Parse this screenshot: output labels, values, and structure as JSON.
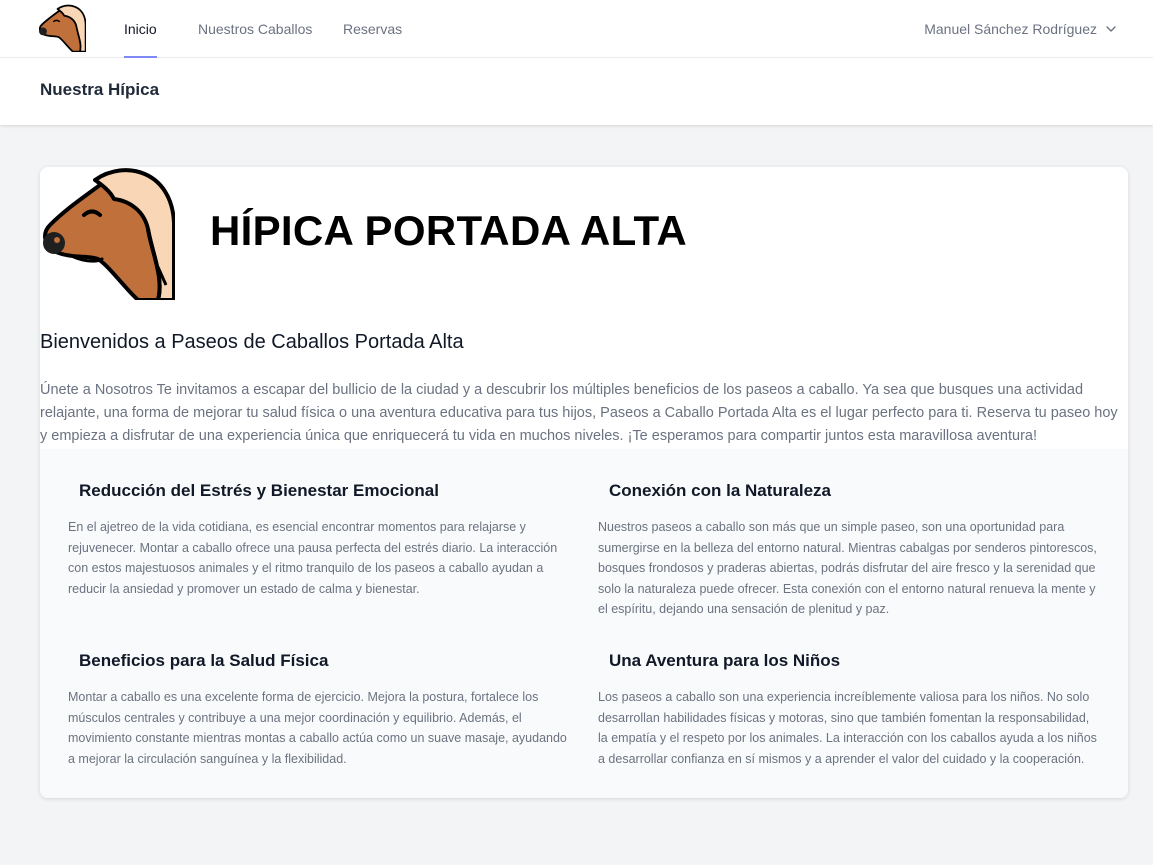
{
  "nav": {
    "links": [
      {
        "label": "Inicio",
        "active": true
      },
      {
        "label": "Nuestros Caballos",
        "active": false
      },
      {
        "label": "Reservas",
        "active": false
      }
    ],
    "user_name": "Manuel Sánchez Rodríguez",
    "logo_icon": "horse-head-icon",
    "dropdown_icon": "chevron-down-icon"
  },
  "header": {
    "title": "Nuestra Hípica"
  },
  "hero": {
    "title": "HÍPICA PORTADA ALTA",
    "image_icon": "horse-head-icon",
    "welcome": "Bienvenidos a Paseos de Caballos Portada Alta",
    "intro": "Únete a Nosotros Te invitamos a escapar del bullicio de la ciudad y a descubrir los múltiples beneficios de los paseos a caballo. Ya sea que busques una actividad relajante, una forma de mejorar tu salud física o una aventura educativa para tus hijos, Paseos a Caballo Portada Alta es el lugar perfecto para ti. Reserva tu paseo hoy y empieza a disfrutar de una experiencia única que enriquecerá tu vida en muchos niveles. ¡Te esperamos para compartir juntos esta maravillosa aventura!"
  },
  "features": [
    {
      "title": "Reducción del Estrés y Bienestar Emocional",
      "text": "En el ajetreo de la vida cotidiana, es esencial encontrar momentos para relajarse y rejuvenecer. Montar a caballo ofrece una pausa perfecta del estrés diario. La interacción con estos majestuosos animales y el ritmo tranquilo de los paseos a caballo ayudan a reducir la ansiedad y promover un estado de calma y bienestar."
    },
    {
      "title": "Conexión con la Naturaleza",
      "text": "Nuestros paseos a caballo son más que un simple paseo, son una oportunidad para sumergirse en la belleza del entorno natural. Mientras cabalgas por senderos pintorescos, bosques frondosos y praderas abiertas, podrás disfrutar del aire fresco y la serenidad que solo la naturaleza puede ofrecer. Esta conexión con el entorno natural renueva la mente y el espíritu, dejando una sensación de plenitud y paz."
    },
    {
      "title": "Beneficios para la Salud Física",
      "text": "Montar a caballo es una excelente forma de ejercicio. Mejora la postura, fortalece los músculos centrales y contribuye a una mejor coordinación y equilibrio. Además, el movimiento constante mientras montas a caballo actúa como un suave masaje, ayudando a mejorar la circulación sanguínea y la flexibilidad."
    },
    {
      "title": "Una Aventura para los Niños",
      "text": "Los paseos a caballo son una experiencia increíblemente valiosa para los niños. No solo desarrollan habilidades físicas y motoras, sino que también fomentan la responsabilidad, la empatía y el respeto por los animales. La interacción con los caballos ayuda a los niños a desarrollar confianza en sí mismos y a aprender el valor del cuidado y la cooperación."
    }
  ],
  "colors": {
    "horse_body": "#c0703a",
    "horse_mane": "#f9d6b5",
    "outline": "#000000",
    "accent": "#818cf8"
  }
}
